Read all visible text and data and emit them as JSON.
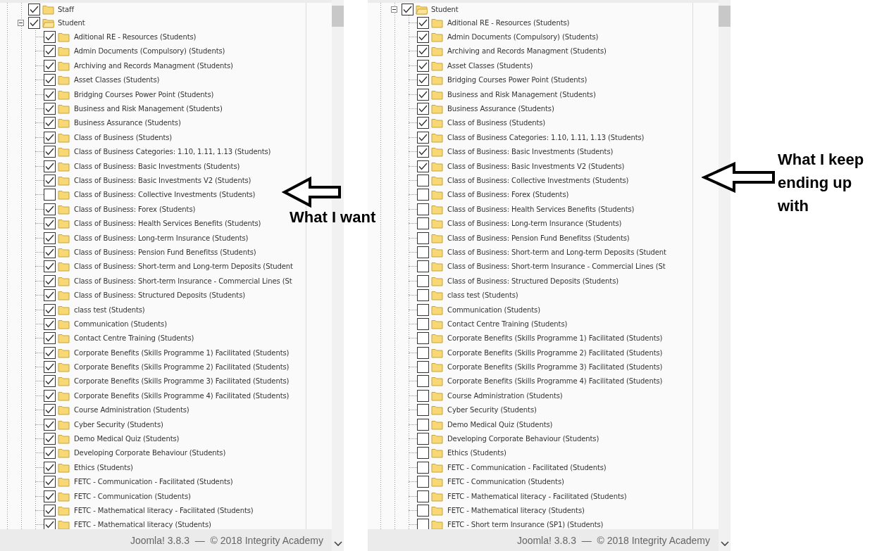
{
  "panels": [
    {
      "tree": [
        {
          "label": "Staff",
          "checked": true
        },
        {
          "label": "Student",
          "checked": true,
          "expanded": true,
          "children": [
            {
              "label": "Aditional RE - Resources (Students)",
              "checked": true
            },
            {
              "label": "Admin Documents (Compulsory) (Students)",
              "checked": true
            },
            {
              "label": "Archiving and Records Managment (Students)",
              "checked": true
            },
            {
              "label": "Asset Classes (Students)",
              "checked": true
            },
            {
              "label": "Bridging Courses Power Point (Students)",
              "checked": true
            },
            {
              "label": "Business and Risk Management (Students)",
              "checked": true
            },
            {
              "label": "Business Assurance (Students)",
              "checked": true
            },
            {
              "label": "Class of Business (Students)",
              "checked": true
            },
            {
              "label": "Class of Business Categories: 1.10, 1.11, 1.13 (Students)",
              "checked": true
            },
            {
              "label": "Class of Business: Basic Investments (Students)",
              "checked": true
            },
            {
              "label": "Class of Business: Basic Investments V2 (Students)",
              "checked": true
            },
            {
              "label": "Class of Business: Collective Investments (Students)",
              "checked": false
            },
            {
              "label": "Class of Business: Forex (Students)",
              "checked": true
            },
            {
              "label": "Class of Business: Health Services Benefits (Students)",
              "checked": true
            },
            {
              "label": "Class of Business: Long-term Insurance (Students)",
              "checked": true
            },
            {
              "label": "Class of Business: Pension Fund Benefitss (Students)",
              "checked": true
            },
            {
              "label": "Class of Business: Short-term and Long-term Deposits (Student",
              "checked": true
            },
            {
              "label": "Class of Business: Short-term Insurance - Commercial Lines (St",
              "checked": true
            },
            {
              "label": "Class of Business: Structured Deposits (Students)",
              "checked": true
            },
            {
              "label": "class test (Students)",
              "checked": true
            },
            {
              "label": "Communication (Students)",
              "checked": true
            },
            {
              "label": "Contact Centre Training (Students)",
              "checked": true
            },
            {
              "label": "Corporate Benefits (Skills Programme 1) Facilitated (Students)",
              "checked": true
            },
            {
              "label": "Corporate Benefits (Skills Programme 2) Facilitated (Students)",
              "checked": true
            },
            {
              "label": "Corporate Benefits (Skills Programme 3) Facilitated (Students)",
              "checked": true
            },
            {
              "label": "Corporate Benefits (Skills Programme 4) Facilitated (Students)",
              "checked": true
            },
            {
              "label": "Course Administration (Students)",
              "checked": true
            },
            {
              "label": "Cyber Security (Students)",
              "checked": true
            },
            {
              "label": "Demo Medical Quiz (Students)",
              "checked": true
            },
            {
              "label": "Developing Corporate Behaviour (Students)",
              "checked": true
            },
            {
              "label": "Ethics (Students)",
              "checked": true
            },
            {
              "label": "FETC - Communication - Facilitated (Students)",
              "checked": true
            },
            {
              "label": "FETC - Communication (Students)",
              "checked": true
            },
            {
              "label": "FETC - Mathematical literacy - Facilitated (Students)",
              "checked": true
            },
            {
              "label": "FETC - Mathematical literacy (Students)",
              "checked": true
            }
          ]
        }
      ],
      "footer": "Joomla! 3.8.3  —  © 2018 Integrity Academy"
    },
    {
      "tree": [
        {
          "label": "Student",
          "checked": true,
          "expanded": true,
          "children": [
            {
              "label": "Aditional RE - Resources (Students)",
              "checked": true
            },
            {
              "label": "Admin Documents (Compulsory) (Students)",
              "checked": true
            },
            {
              "label": "Archiving and Records Managment (Students)",
              "checked": true
            },
            {
              "label": "Asset Classes (Students)",
              "checked": true
            },
            {
              "label": "Bridging Courses Power Point (Students)",
              "checked": true
            },
            {
              "label": "Business and Risk Management (Students)",
              "checked": true
            },
            {
              "label": "Business Assurance (Students)",
              "checked": true
            },
            {
              "label": "Class of Business (Students)",
              "checked": true
            },
            {
              "label": "Class of Business Categories: 1.10, 1.11, 1.13 (Students)",
              "checked": true
            },
            {
              "label": "Class of Business: Basic Investments (Students)",
              "checked": true
            },
            {
              "label": "Class of Business: Basic Investments V2 (Students)",
              "checked": true
            },
            {
              "label": "Class of Business: Collective Investments (Students)",
              "checked": false
            },
            {
              "label": "Class of Business: Forex (Students)",
              "checked": false
            },
            {
              "label": "Class of Business: Health Services Benefits (Students)",
              "checked": false
            },
            {
              "label": "Class of Business: Long-term Insurance (Students)",
              "checked": false
            },
            {
              "label": "Class of Business: Pension Fund Benefitss (Students)",
              "checked": false
            },
            {
              "label": "Class of Business: Short-term and Long-term Deposits (Student",
              "checked": false
            },
            {
              "label": "Class of Business: Short-term Insurance - Commercial Lines (St",
              "checked": false
            },
            {
              "label": "Class of Business: Structured Deposits (Students)",
              "checked": false
            },
            {
              "label": "class test (Students)",
              "checked": false
            },
            {
              "label": "Communication (Students)",
              "checked": false
            },
            {
              "label": "Contact Centre Training (Students)",
              "checked": false
            },
            {
              "label": "Corporate Benefits (Skills Programme 1) Facilitated (Students)",
              "checked": false
            },
            {
              "label": "Corporate Benefits (Skills Programme 2) Facilitated (Students)",
              "checked": false
            },
            {
              "label": "Corporate Benefits (Skills Programme 3) Facilitated (Students)",
              "checked": false
            },
            {
              "label": "Corporate Benefits (Skills Programme 4) Facilitated (Students)",
              "checked": false
            },
            {
              "label": "Course Administration (Students)",
              "checked": false
            },
            {
              "label": "Cyber Security (Students)",
              "checked": false
            },
            {
              "label": "Demo Medical Quiz (Students)",
              "checked": false
            },
            {
              "label": "Developing Corporate Behaviour (Students)",
              "checked": false
            },
            {
              "label": "Ethics (Students)",
              "checked": false
            },
            {
              "label": "FETC - Communication - Facilitated (Students)",
              "checked": false
            },
            {
              "label": "FETC - Communication (Students)",
              "checked": false
            },
            {
              "label": "FETC - Mathematical literacy - Facilitated (Students)",
              "checked": false
            },
            {
              "label": "FETC - Mathematical literacy (Students)",
              "checked": false
            },
            {
              "label": "FETC - Short term Insurance (SP1) (Students)",
              "checked": false
            }
          ]
        }
      ],
      "footer": "Joomla! 3.8.3  —  © 2018 Integrity Academy"
    }
  ],
  "annotations": [
    {
      "text": "What I want"
    },
    {
      "text": "What I keep ending up with"
    }
  ]
}
